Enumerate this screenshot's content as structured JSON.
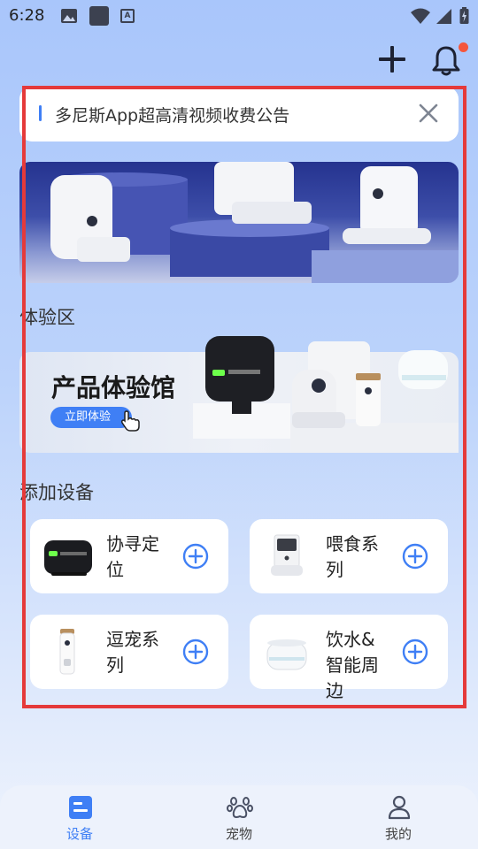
{
  "status_bar": {
    "time": "6:28",
    "a_badge": "A"
  },
  "top_actions": {
    "add_icon": "plus-icon",
    "bell_icon": "bell-icon",
    "bell_badge_color": "#f5563c"
  },
  "notice": {
    "text": "多尼斯App超高清视频收费公告",
    "accent": "#3f7ff5"
  },
  "experience": {
    "section_title": "体验区",
    "card_title": "产品体验馆",
    "button_label": "立即体验"
  },
  "add_device": {
    "section_title": "添加设备",
    "items": [
      {
        "label": "协寻定位",
        "icon": "tracker-thumb"
      },
      {
        "label": "喂食系列",
        "icon": "feeder-thumb"
      },
      {
        "label": "逗宠系列",
        "icon": "treat-camera-thumb"
      },
      {
        "label": "饮水&智能周边",
        "icon": "water-fountain-thumb"
      }
    ]
  },
  "bottom_nav": {
    "items": [
      {
        "label": "设备",
        "icon": "device-icon",
        "active": true
      },
      {
        "label": "宠物",
        "icon": "paw-icon",
        "active": false
      },
      {
        "label": "我的",
        "icon": "user-icon",
        "active": false
      }
    ],
    "active_color": "#3f7ff5"
  }
}
